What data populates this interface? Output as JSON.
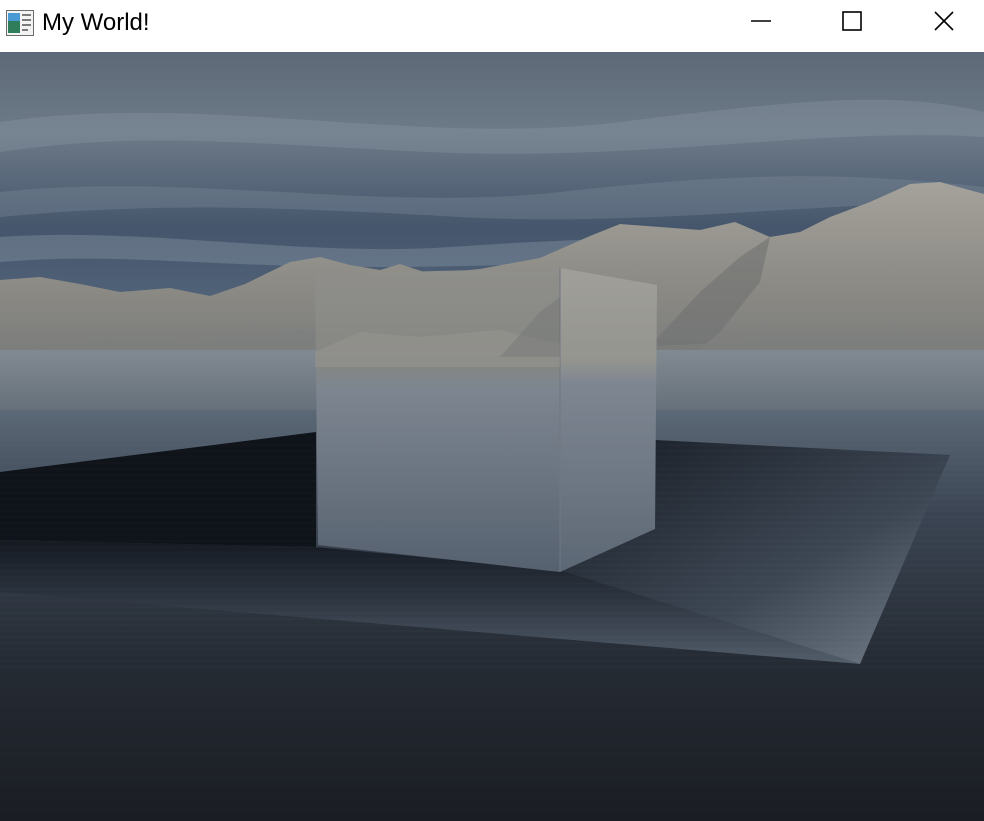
{
  "window": {
    "title": "My World!",
    "icon": "app-window-icon",
    "controls": [
      {
        "name": "minimize",
        "icon": "minimize-icon"
      },
      {
        "name": "maximize",
        "icon": "maximize-icon"
      },
      {
        "name": "close",
        "icon": "close-icon"
      }
    ]
  },
  "scene": {
    "elements": [
      "sky",
      "mountains",
      "water",
      "dark-plane",
      "reflective-cube"
    ],
    "colors": {
      "sky_top": "#5b6878",
      "sky_mid": "#44546a",
      "sky_horizon": "#8a98a6",
      "mountain": "#8e8c86",
      "water_far": "#6d7a88",
      "water_near": "#1b1f26",
      "plane": "#151a22"
    }
  }
}
